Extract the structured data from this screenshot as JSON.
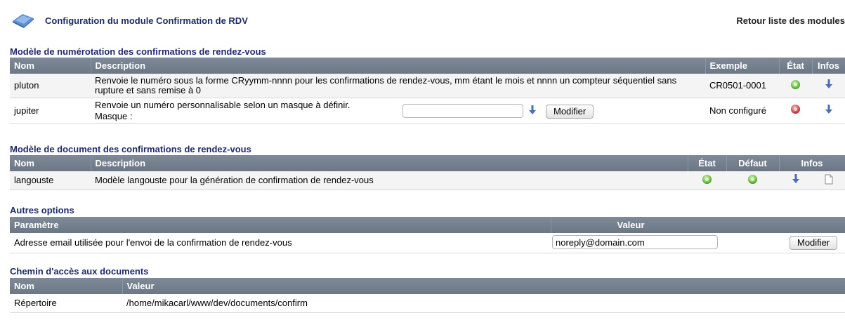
{
  "header": {
    "title": "Configuration du module Confirmation de RDV",
    "back_link": "Retour liste des modules",
    "module_icon": "module-folder-icon"
  },
  "numbering": {
    "section_title": "Modèle de numérotation des confirmations de rendez-vous",
    "columns": {
      "name": "Nom",
      "description": "Description",
      "example": "Exemple",
      "state": "État",
      "infos": "Infos"
    },
    "rows": [
      {
        "name": "pluton",
        "description": "Renvoie le numéro sous la forme CRyymm-nnnn pour les confirmations de rendez-vous, mm étant le mois et nnnn un compteur séquentiel sans rupture et sans remise à 0",
        "example": "CR0501-0001",
        "state": "enabled"
      },
      {
        "name": "jupiter",
        "description": "Renvoie un numéro personnalisable selon un masque à définir.",
        "mask_label": "Masque :",
        "mask_value": "",
        "modify_button": "Modifier",
        "example": "Non configuré",
        "state": "disabled"
      }
    ]
  },
  "documents": {
    "section_title": "Modèle de document des confirmations de rendez-vous",
    "columns": {
      "name": "Nom",
      "description": "Description",
      "state": "État",
      "default": "Défaut",
      "infos": "Infos"
    },
    "rows": [
      {
        "name": "langouste",
        "description": "Modèle langouste pour la génération de confirmation de rendez-vous",
        "state": "enabled",
        "default": "enabled"
      }
    ]
  },
  "options": {
    "section_title": "Autres options",
    "columns": {
      "parameter": "Paramètre",
      "value": "Valeur"
    },
    "rows": [
      {
        "label": "Adresse email utilisée pour l'envoi de la confirmation de rendez-vous",
        "value": "noreply@domain.com",
        "modify_button": "Modifier"
      }
    ]
  },
  "paths": {
    "section_title": "Chemin d'accès aux documents",
    "columns": {
      "name": "Nom",
      "value": "Valeur"
    },
    "rows": [
      {
        "name": "Répertoire",
        "value": "/home/mikacarl/www/dev/documents/confirm"
      }
    ]
  },
  "colors": {
    "header_bar": "#6c7786",
    "section_title": "#1f2a6d",
    "status_on": "#5cbb2f",
    "status_off": "#d03838",
    "info_icon": "#4a6fb5"
  }
}
